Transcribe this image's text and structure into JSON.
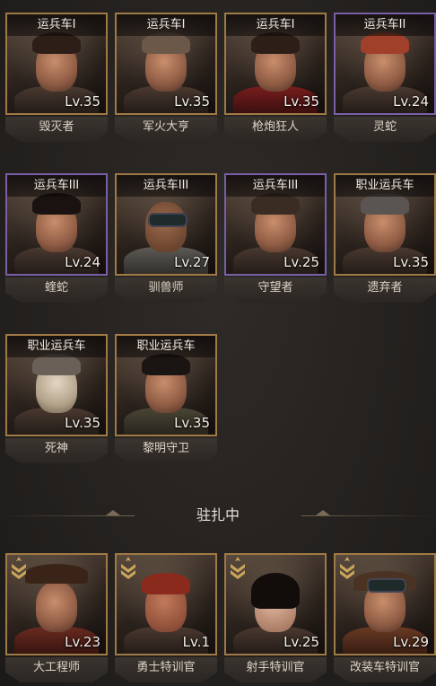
{
  "vehicle_heroes": [
    {
      "badge": "运兵车I",
      "level": "Lv.35",
      "name": "毁灭者",
      "frame": "gold"
    },
    {
      "badge": "运兵车I",
      "level": "Lv.35",
      "name": "军火大亨",
      "frame": "gold"
    },
    {
      "badge": "运兵车I",
      "level": "Lv.35",
      "name": "枪炮狂人",
      "frame": "gold"
    },
    {
      "badge": "运兵车II",
      "level": "Lv.24",
      "name": "灵蛇",
      "frame": "purple"
    },
    {
      "badge": "运兵车III",
      "level": "Lv.24",
      "name": "蝰蛇",
      "frame": "purple"
    },
    {
      "badge": "运兵车III",
      "level": "Lv.27",
      "name": "驯兽师",
      "frame": "gold"
    },
    {
      "badge": "运兵车III",
      "level": "Lv.25",
      "name": "守望者",
      "frame": "purple"
    },
    {
      "badge": "职业运兵车",
      "level": "Lv.35",
      "name": "遗弃者",
      "frame": "gold"
    },
    {
      "badge": "职业运兵车",
      "level": "Lv.35",
      "name": "死神",
      "frame": "gold"
    },
    {
      "badge": "职业运兵车",
      "level": "Lv.35",
      "name": "黎明守卫",
      "frame": "gold"
    }
  ],
  "section_title": "驻扎中",
  "stationed_heroes": [
    {
      "level": "Lv.23",
      "name": "大工程师"
    },
    {
      "level": "Lv.1",
      "name": "勇士特训官"
    },
    {
      "level": "Lv.25",
      "name": "射手特训官"
    },
    {
      "level": "Lv.29",
      "name": "改装车特训官"
    }
  ],
  "colors": {
    "gold_frame": "#a07a45",
    "purple_frame": "#7a5fa8",
    "rank_icon": "#c9a45a"
  }
}
